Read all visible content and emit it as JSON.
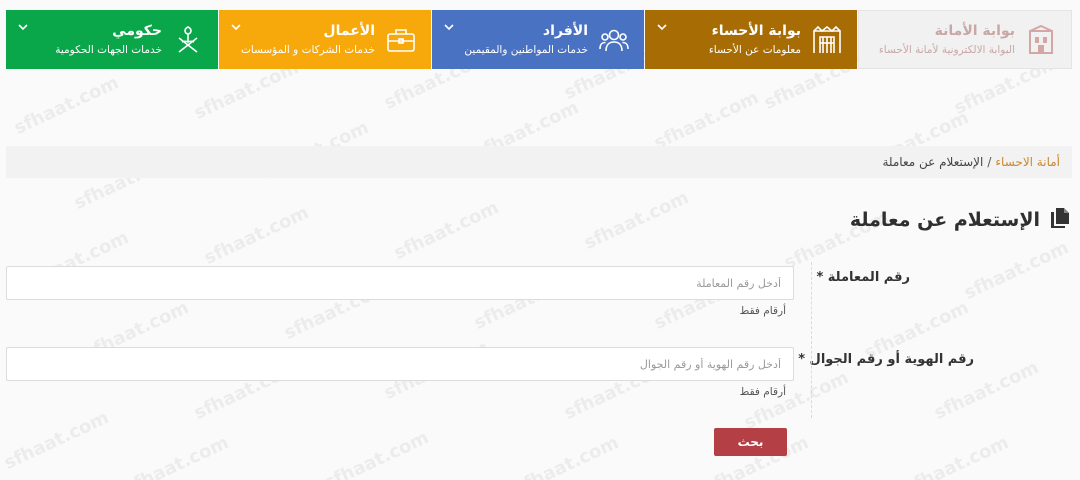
{
  "nav": {
    "tiles": [
      {
        "title": "بوابة الأمانة",
        "subtitle": "البوابة الالكترونية لأمانة الأحساء",
        "icon": "municipality-building-icon"
      },
      {
        "title": "بوابة الأحساء",
        "subtitle": "معلومات عن الأحساء",
        "icon": "gate-icon"
      },
      {
        "title": "الأفراد",
        "subtitle": "خدمات المواطنين والمقيمين",
        "icon": "users-icon"
      },
      {
        "title": "الأعمال",
        "subtitle": "خدمات الشركات و المؤسسات",
        "icon": "briefcase-icon"
      },
      {
        "title": "حكومي",
        "subtitle": "خدمات الجهات الحكومية",
        "icon": "saudi-emblem-icon"
      }
    ]
  },
  "breadcrumb": {
    "home": "أمانة الاحساء",
    "separator": "/",
    "current": "الإستعلام عن معاملة"
  },
  "page": {
    "title": "الإستعلام عن معاملة",
    "title_icon": "copy-document-icon"
  },
  "form": {
    "transaction": {
      "label": "رقم المعاملة *",
      "value": "",
      "placeholder": "أدخل رقم المعاملة",
      "hint": "أرقام فقط"
    },
    "identity": {
      "label": "رقم الهوية أو رقم الجوال *",
      "value": "",
      "placeholder": "أدخل رقم الهوية أو رقم الجوال",
      "hint": "أرقام فقط"
    },
    "submit_label": "بحث"
  },
  "watermark": "sfhaat.com",
  "colors": {
    "ahsa": "#a86c05",
    "afrad": "#4a72c3",
    "aamal": "#f7a90c",
    "hukumi": "#0aa64a",
    "button": "#b43f44",
    "link": "#c9892a"
  }
}
